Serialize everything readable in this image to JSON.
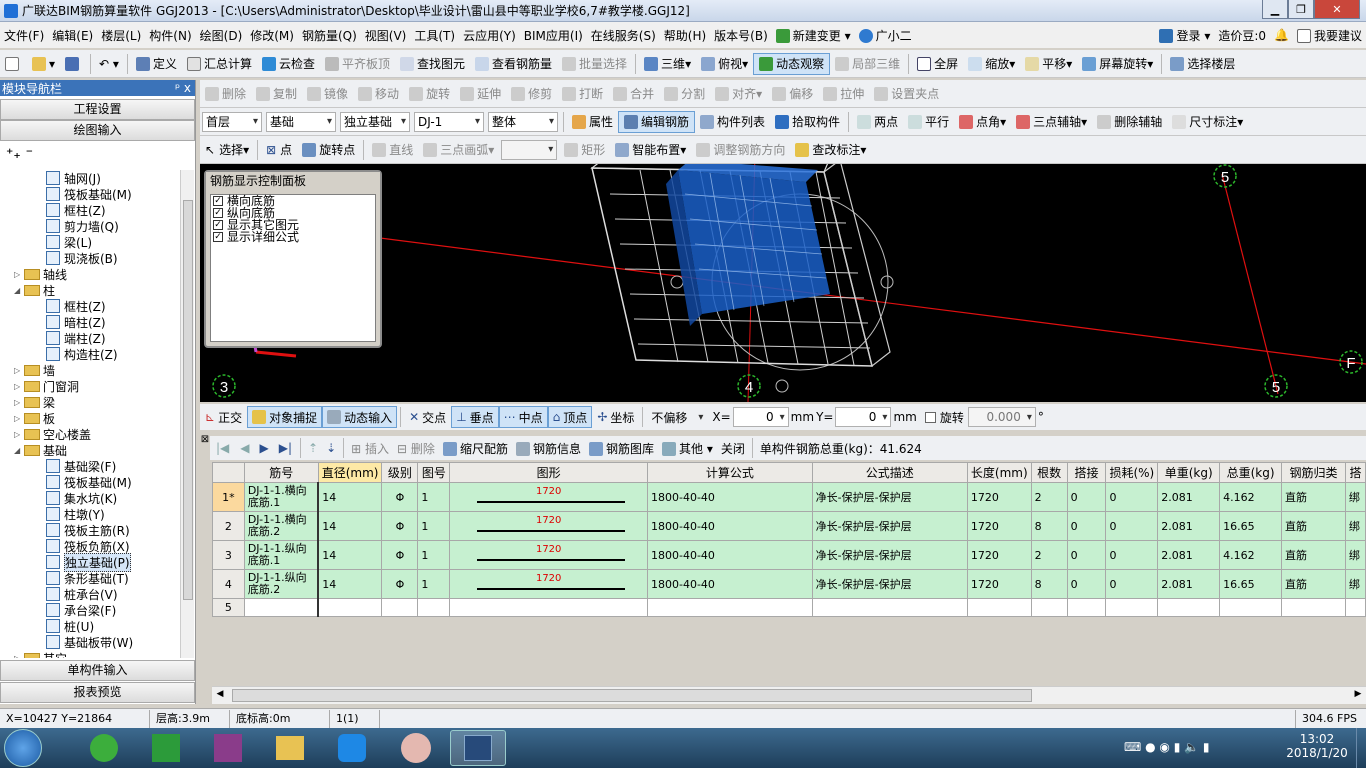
{
  "window": {
    "title": "广联达BIM钢筋算量软件 GGJ2013 - [C:\\Users\\Administrator\\Desktop\\毕业设计\\雷山县中等职业学校6,7#教学楼.GGJ12]"
  },
  "menu": [
    "文件(F)",
    "编辑(E)",
    "楼层(L)",
    "构件(N)",
    "绘图(D)",
    "修改(M)",
    "钢筋量(Q)",
    "视图(V)",
    "工具(T)",
    "云应用(Y)",
    "BIM应用(I)",
    "在线服务(S)",
    "帮助(H)",
    "版本号(B)",
    "新建变更",
    "广小二"
  ],
  "menu_right": {
    "login": "登录",
    "beans": "造价豆:0",
    "suggest": "我要建议"
  },
  "toolbar1": [
    "定义",
    "汇总计算",
    "云检查",
    "平齐板顶",
    "查找图元",
    "查看钢筋量",
    "批量选择",
    "三维",
    "俯视",
    "动态观察",
    "局部三维",
    "全屏",
    "缩放",
    "平移",
    "屏幕旋转",
    "选择楼层"
  ],
  "toolbar2": [
    "删除",
    "复制",
    "镜像",
    "移动",
    "旋转",
    "延伸",
    "修剪",
    "打断",
    "合并",
    "分割",
    "对齐",
    "偏移",
    "拉伸",
    "设置夹点"
  ],
  "toolbar3": {
    "floor": "首层",
    "category": "基础",
    "type": "独立基础",
    "component": "DJ-1",
    "part": "整体",
    "items": [
      "属性",
      "编辑钢筋",
      "构件列表",
      "拾取构件",
      "两点",
      "平行",
      "点角",
      "三点辅轴",
      "删除辅轴",
      "尺寸标注"
    ]
  },
  "toolbar4": [
    "选择",
    "点",
    "旋转点",
    "直线",
    "三点画弧",
    "矩形",
    "智能布置",
    "调整钢筋方向",
    "查改标注"
  ],
  "nav": {
    "title": "模块导航栏",
    "pin": "ᵖ x",
    "btn_project": "工程设置",
    "btn_draw": "绘图输入",
    "btn_single": "单构件输入",
    "btn_report": "报表预览"
  },
  "tree": [
    {
      "label": "轴网(J)",
      "lvl": 2
    },
    {
      "label": "筏板基础(M)",
      "lvl": 2
    },
    {
      "label": "框柱(Z)",
      "lvl": 2
    },
    {
      "label": "剪力墙(Q)",
      "lvl": 2
    },
    {
      "label": "梁(L)",
      "lvl": 2
    },
    {
      "label": "现浇板(B)",
      "lvl": 2
    },
    {
      "label": "轴线",
      "lvl": 1,
      "exp": "+"
    },
    {
      "label": "柱",
      "lvl": 1,
      "exp": "-"
    },
    {
      "label": "框柱(Z)",
      "lvl": 2
    },
    {
      "label": "暗柱(Z)",
      "lvl": 2
    },
    {
      "label": "端柱(Z)",
      "lvl": 2
    },
    {
      "label": "构造柱(Z)",
      "lvl": 2
    },
    {
      "label": "墙",
      "lvl": 1,
      "exp": "+"
    },
    {
      "label": "门窗洞",
      "lvl": 1,
      "exp": "+"
    },
    {
      "label": "梁",
      "lvl": 1,
      "exp": "+"
    },
    {
      "label": "板",
      "lvl": 1,
      "exp": "+"
    },
    {
      "label": "空心楼盖",
      "lvl": 1,
      "exp": "+"
    },
    {
      "label": "基础",
      "lvl": 1,
      "exp": "-"
    },
    {
      "label": "基础梁(F)",
      "lvl": 2
    },
    {
      "label": "筏板基础(M)",
      "lvl": 2
    },
    {
      "label": "集水坑(K)",
      "lvl": 2
    },
    {
      "label": "柱墩(Y)",
      "lvl": 2
    },
    {
      "label": "筏板主筋(R)",
      "lvl": 2
    },
    {
      "label": "筏板负筋(X)",
      "lvl": 2
    },
    {
      "label": "独立基础(P)",
      "lvl": 2,
      "sel": true
    },
    {
      "label": "条形基础(T)",
      "lvl": 2
    },
    {
      "label": "桩承台(V)",
      "lvl": 2
    },
    {
      "label": "承台梁(F)",
      "lvl": 2
    },
    {
      "label": "桩(U)",
      "lvl": 2
    },
    {
      "label": "基础板带(W)",
      "lvl": 2
    },
    {
      "label": "其它",
      "lvl": 1,
      "exp": "+"
    }
  ],
  "panel": {
    "title": "钢筋显示控制面板",
    "items": [
      "横向底筋",
      "纵向底筋",
      "显示其它图元",
      "显示详细公式"
    ]
  },
  "axis_labels": {
    "a3": "3",
    "a4": "4",
    "a5top": "5",
    "a5bot": "5",
    "aF": "F"
  },
  "snapbar": {
    "items": [
      "正交",
      "对象捕捉",
      "动态输入",
      "交点",
      "垂点",
      "中点",
      "顶点",
      "坐标"
    ],
    "offset_mode": "不偏移",
    "x_label": "X=",
    "x_val": "0",
    "mm1": "mm",
    "y_label": "Y=",
    "y_val": "0",
    "mm2": "mm",
    "rotate": "旋转",
    "rotate_val": "0.000",
    "deg": "°"
  },
  "gridtb": {
    "items": [
      "插入",
      "删除",
      "缩尺配筋",
      "钢筋信息",
      "钢筋图库",
      "其他",
      "关闭"
    ],
    "total": "单构件钢筋总重(kg)：41.624"
  },
  "table": {
    "headers": [
      "",
      "筋号",
      "直径(mm)",
      "级别",
      "图号",
      "图形",
      "计算公式",
      "公式描述",
      "长度(mm)",
      "根数",
      "搭接",
      "损耗(%)",
      "单重(kg)",
      "总重(kg)",
      "钢筋归类",
      "搭"
    ],
    "rows": [
      {
        "n": "1*",
        "name1": "DJ-1-1.横向",
        "name2": "底筋.1",
        "dia": "14",
        "grade": "Φ",
        "fig": "1",
        "shape": "1720",
        "formula": "1800-40-40",
        "desc": "净长-保护层-保护层",
        "len": "1720",
        "count": "2",
        "lap": "0",
        "loss": "0",
        "unit": "2.081",
        "total": "4.162",
        "cls": "直筋",
        "ext": "绑"
      },
      {
        "n": "2",
        "name1": "DJ-1-1.横向",
        "name2": "底筋.2",
        "dia": "14",
        "grade": "Φ",
        "fig": "1",
        "shape": "1720",
        "formula": "1800-40-40",
        "desc": "净长-保护层-保护层",
        "len": "1720",
        "count": "8",
        "lap": "0",
        "loss": "0",
        "unit": "2.081",
        "total": "16.65",
        "cls": "直筋",
        "ext": "绑"
      },
      {
        "n": "3",
        "name1": "DJ-1-1.纵向",
        "name2": "底筋.1",
        "dia": "14",
        "grade": "Φ",
        "fig": "1",
        "shape": "1720",
        "formula": "1800-40-40",
        "desc": "净长-保护层-保护层",
        "len": "1720",
        "count": "2",
        "lap": "0",
        "loss": "0",
        "unit": "2.081",
        "total": "4.162",
        "cls": "直筋",
        "ext": "绑"
      },
      {
        "n": "4",
        "name1": "DJ-1-1.纵向",
        "name2": "底筋.2",
        "dia": "14",
        "grade": "Φ",
        "fig": "1",
        "shape": "1720",
        "formula": "1800-40-40",
        "desc": "净长-保护层-保护层",
        "len": "1720",
        "count": "8",
        "lap": "0",
        "loss": "0",
        "unit": "2.081",
        "total": "16.65",
        "cls": "直筋",
        "ext": "绑"
      }
    ],
    "empty_row": "5"
  },
  "status": {
    "coords": "X=10427 Y=21864",
    "floor_h": "层高:3.9m",
    "bottom_h": "底标高:0m",
    "sel": "1(1)",
    "fps": "304.6 FPS"
  },
  "taskbar": {
    "time": "13:02",
    "date": "2018/1/20"
  }
}
